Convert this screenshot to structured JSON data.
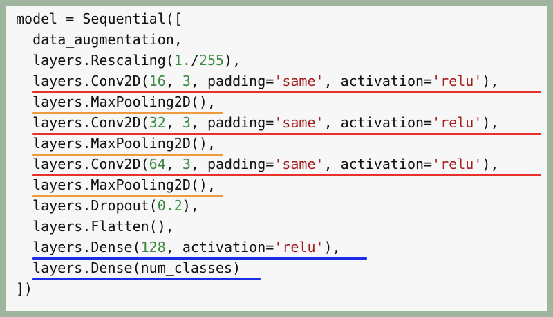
{
  "colors": {
    "frame": "#9fb59e",
    "background": "#f7f7f7",
    "text": "#111111",
    "number": "#3b8a3f",
    "string": "#a51e1e",
    "underline_conv": "#e8312b",
    "underline_pool": "#f09a3e",
    "underline_dense": "#1b2ee6"
  },
  "code": {
    "line1": "model = Sequential([",
    "line2": "  data_augmentation,",
    "line3": {
      "a": "  layers.Rescaling(",
      "n1": "1.",
      "b": "/",
      "n2": "255",
      "c": "),"
    },
    "line4": {
      "a": "  layers.Conv2D(",
      "n1": "16",
      "b": ", ",
      "n2": "3",
      "c": ", padding=",
      "s1": "'same'",
      "d": ", activation=",
      "s2": "'relu'",
      "e": "),"
    },
    "line5": "  layers.MaxPooling2D(),",
    "line6": {
      "a": "  layers.Conv2D(",
      "n1": "32",
      "b": ", ",
      "n2": "3",
      "c": ", padding=",
      "s1": "'same'",
      "d": ", activation=",
      "s2": "'relu'",
      "e": "),"
    },
    "line7": "  layers.MaxPooling2D(),",
    "line8": {
      "a": "  layers.Conv2D(",
      "n1": "64",
      "b": ", ",
      "n2": "3",
      "c": ", padding=",
      "s1": "'same'",
      "d": ", activation=",
      "s2": "'relu'",
      "e": "),"
    },
    "line9": "  layers.MaxPooling2D(),",
    "line10": {
      "a": "  layers.Dropout(",
      "n1": "0.2",
      "b": "),"
    },
    "line11": "  layers.Flatten(),",
    "line12": {
      "a": "  layers.Dense(",
      "n1": "128",
      "b": ", activation=",
      "s1": "'relu'",
      "c": "),"
    },
    "line13": "  layers.Dense(num_classes)",
    "line14": "])"
  }
}
